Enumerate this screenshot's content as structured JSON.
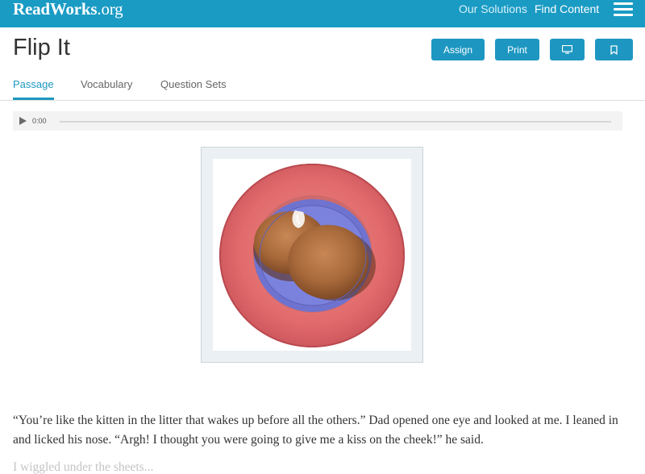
{
  "header": {
    "logo_text": "ReadWorks",
    "logo_suffix": ".org",
    "nav": [
      "Our Solutions",
      "Find Content"
    ],
    "brand_color": "#1a9bc4"
  },
  "title": "Flip It",
  "actions": {
    "assign_label": "Assign",
    "print_label": "Print",
    "present_icon": "monitor-icon",
    "bookmark_icon": "bookmark-icon"
  },
  "tabs": [
    {
      "label": "Passage",
      "active": true
    },
    {
      "label": "Vocabulary",
      "active": false
    },
    {
      "label": "Question Sets",
      "active": false
    }
  ],
  "audio": {
    "time": "0:00",
    "progress": 0
  },
  "passage": {
    "paragraph_1": "“You’re like the kitten in the litter that wakes up before all the others.” Dad opened one eye and looked at me. I leaned in and licked his nose. “Argh! I thought you were going to give me a kiss on the cheek!” he said.",
    "paragraph_2": "I wiggled under the sheets..."
  }
}
